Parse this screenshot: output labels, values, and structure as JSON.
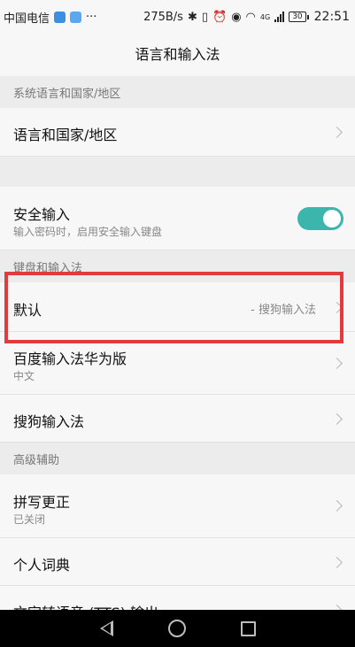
{
  "status_bar": {
    "carrier": "中国电信",
    "more": "···",
    "speed": "275B/s",
    "network": "4G",
    "battery": "30",
    "time": "22:51"
  },
  "header": {
    "title": "语言和输入法"
  },
  "sections": {
    "system_language": "系统语言和国家/地区",
    "keyboard": "键盘和输入法",
    "advanced": "高级辅助"
  },
  "rows": {
    "language_region": {
      "title": "语言和国家/地区"
    },
    "secure_input": {
      "title": "安全输入",
      "subtitle": "输入密码时，启用安全输入键盘",
      "enabled": true
    },
    "default": {
      "title": "默认",
      "value": "- 搜狗输入法"
    },
    "baidu": {
      "title": "百度输入法华为版",
      "subtitle": "中文"
    },
    "sogou": {
      "title": "搜狗输入法"
    },
    "spell_check": {
      "title": "拼写更正",
      "subtitle": "已关闭"
    },
    "personal_dictionary": {
      "title": "个人词典"
    },
    "tts": {
      "title": "文字转语音 (TTS) 输出"
    }
  },
  "colors": {
    "toggle_on": "#3cb6ad",
    "highlight": "#e33b3b"
  }
}
